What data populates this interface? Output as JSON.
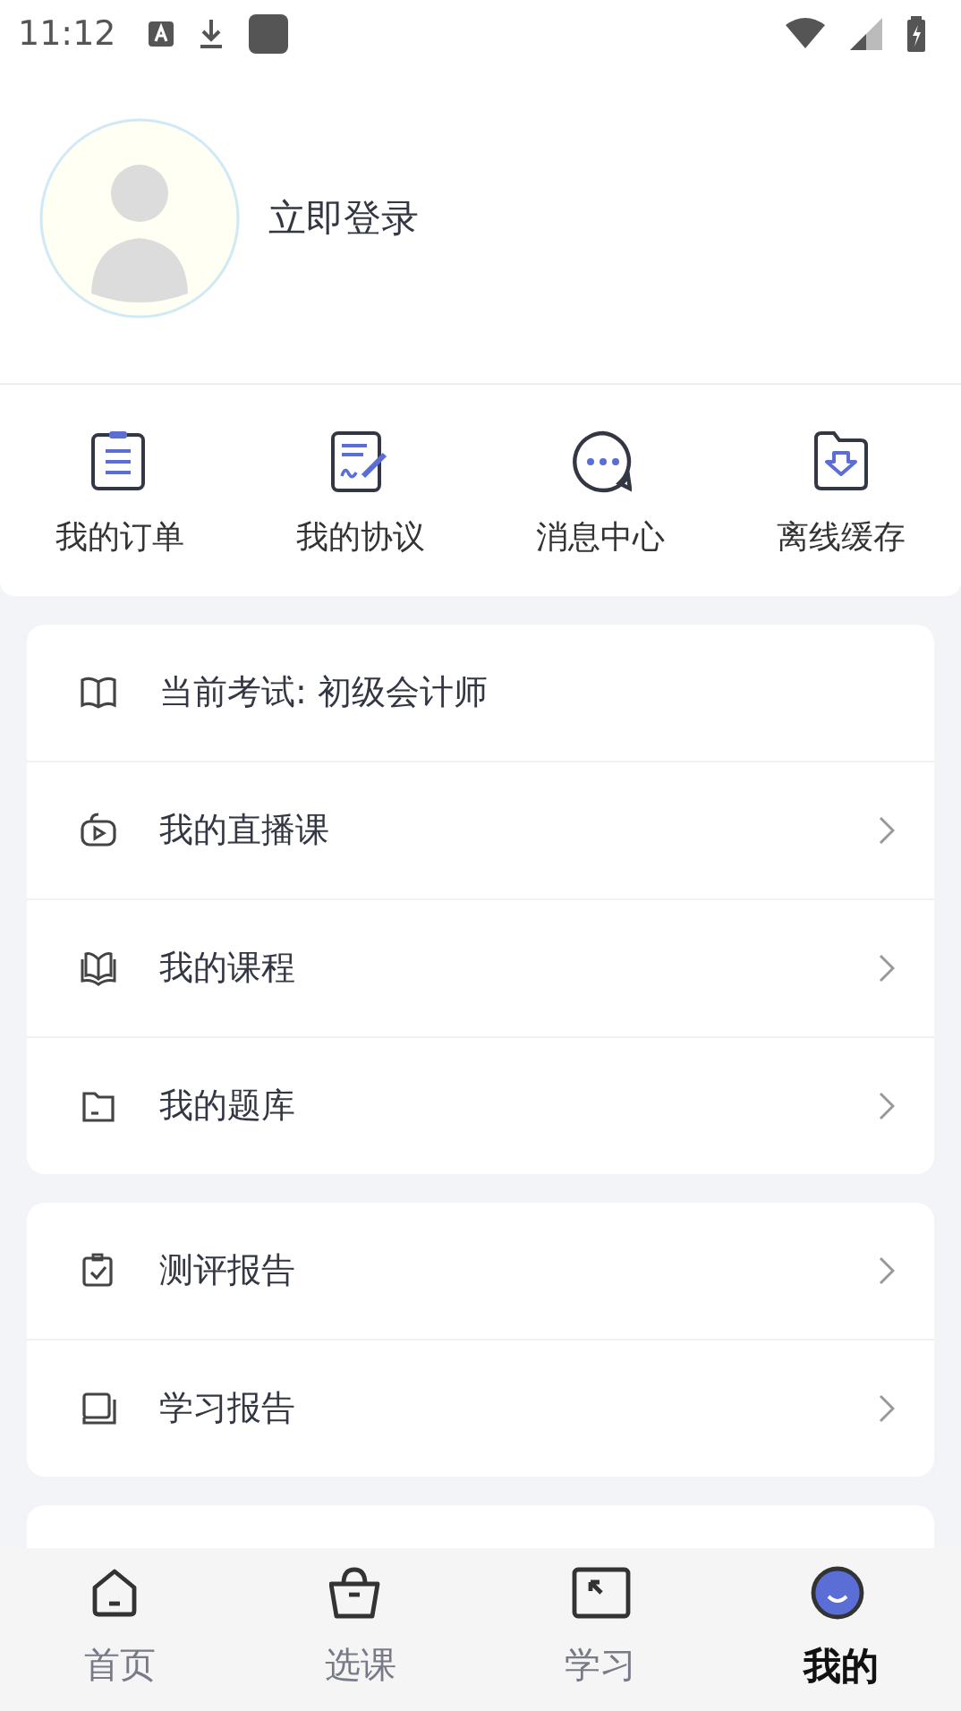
{
  "status_bar": {
    "time": "11:12"
  },
  "profile": {
    "login": "立即登录"
  },
  "shortcuts": [
    {
      "label": "我的订单"
    },
    {
      "label": "我的协议"
    },
    {
      "label": "消息中心"
    },
    {
      "label": "离线缓存"
    }
  ],
  "menu_groups": [
    {
      "items": [
        {
          "label": "当前考试: 初级会计师",
          "arrow": false
        },
        {
          "label": "我的直播课",
          "arrow": true
        },
        {
          "label": "我的课程",
          "arrow": true
        },
        {
          "label": "我的题库",
          "arrow": true
        }
      ]
    },
    {
      "items": [
        {
          "label": "测评报告",
          "arrow": true
        },
        {
          "label": "学习报告",
          "arrow": true
        }
      ]
    }
  ],
  "tabs": [
    {
      "label": "首页",
      "selected": false
    },
    {
      "label": "选课",
      "selected": false
    },
    {
      "label": "学习",
      "selected": false
    },
    {
      "label": "我的",
      "selected": true
    }
  ]
}
